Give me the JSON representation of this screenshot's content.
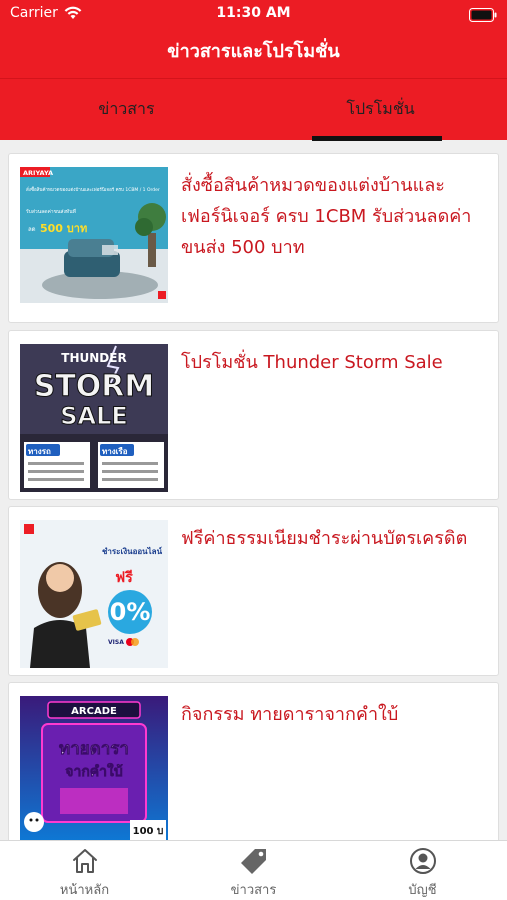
{
  "status_bar": {
    "carrier": "Carrier",
    "time": "11:30 AM"
  },
  "header": {
    "title": "ข่าวสารและโปรโมชั่น"
  },
  "tabs": [
    {
      "label": "ข่าวสาร",
      "active": false
    },
    {
      "label": "โปรโมชั่น",
      "active": true
    }
  ],
  "cards": [
    {
      "title": "สั่งซื้อสินค้าหมวดของแต่งบ้านและเฟอร์นิเจอร์ ครบ 1CBM รับส่วนลดค่าขนส่ง 500 บาท",
      "image": {
        "brand": "ARIYAYA",
        "caption": "สั่งซื้อสินค้าหมวดของแต่งบ้านและเฟอร์นิเจอร์ ครบ 1CBM / 1 Order",
        "caption2": "รับส่วนลดค่าขนส่งทันที",
        "discount_prefix": "ลด",
        "discount": "500 บาท"
      }
    },
    {
      "title": "โปรโมชั่น Thunder Storm Sale",
      "image": {
        "word1": "THUNDER",
        "word2": "STORM",
        "word3": "SALE",
        "truck_label": "ทางรถ",
        "ship_label": "ทางเรือ"
      }
    },
    {
      "title": "ฟรีค่าธรรมเนียมชำระผ่านบัตรเครดิต",
      "image": {
        "line1": "ชำระเงินออนไลน์",
        "free": "ฟรี",
        "percent": "0%",
        "cards": "VISA"
      }
    },
    {
      "title": "กิจกรรม ทายดาราจากคำใบ้",
      "image": {
        "arcade": "ARCADE",
        "line1": "ทายดารา",
        "line2": "จากคำใบ้",
        "reward": "100 บ"
      }
    }
  ],
  "bottom_tabs": [
    {
      "label": "หน้าหลัก",
      "icon": "home-icon"
    },
    {
      "label": "ข่าวสาร",
      "icon": "tag-icon"
    },
    {
      "label": "บัญชี",
      "icon": "account-icon"
    }
  ],
  "colors": {
    "brand_red": "#ec1c24",
    "title_red": "#c91820"
  }
}
